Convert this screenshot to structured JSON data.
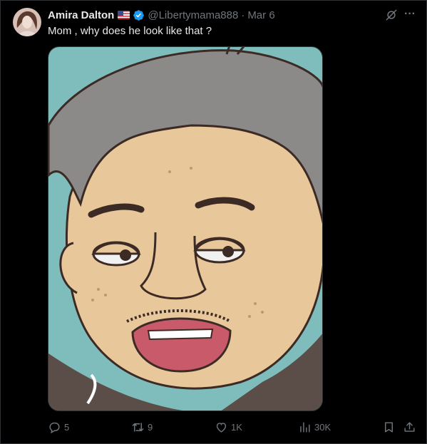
{
  "post": {
    "author_name": "Amira Dalton",
    "handle": "@Libertymama888",
    "separator": "·",
    "date": "Mar 6",
    "text": "Mom , why does he look like that ?",
    "more_label": "···"
  },
  "actions": {
    "replies": "5",
    "reposts": "9",
    "likes": "1K",
    "views": "30K"
  },
  "colors": {
    "background": "#000000",
    "text_primary": "#e7e9ea",
    "text_secondary": "#71767b",
    "verified": "#1d9bf0",
    "border": "#2f3336"
  },
  "icons": [
    "flag-us-icon",
    "verified-badge-icon",
    "grok-icon",
    "more-icon",
    "reply-icon",
    "repost-icon",
    "like-icon",
    "views-icon",
    "bookmark-icon",
    "share-icon"
  ]
}
